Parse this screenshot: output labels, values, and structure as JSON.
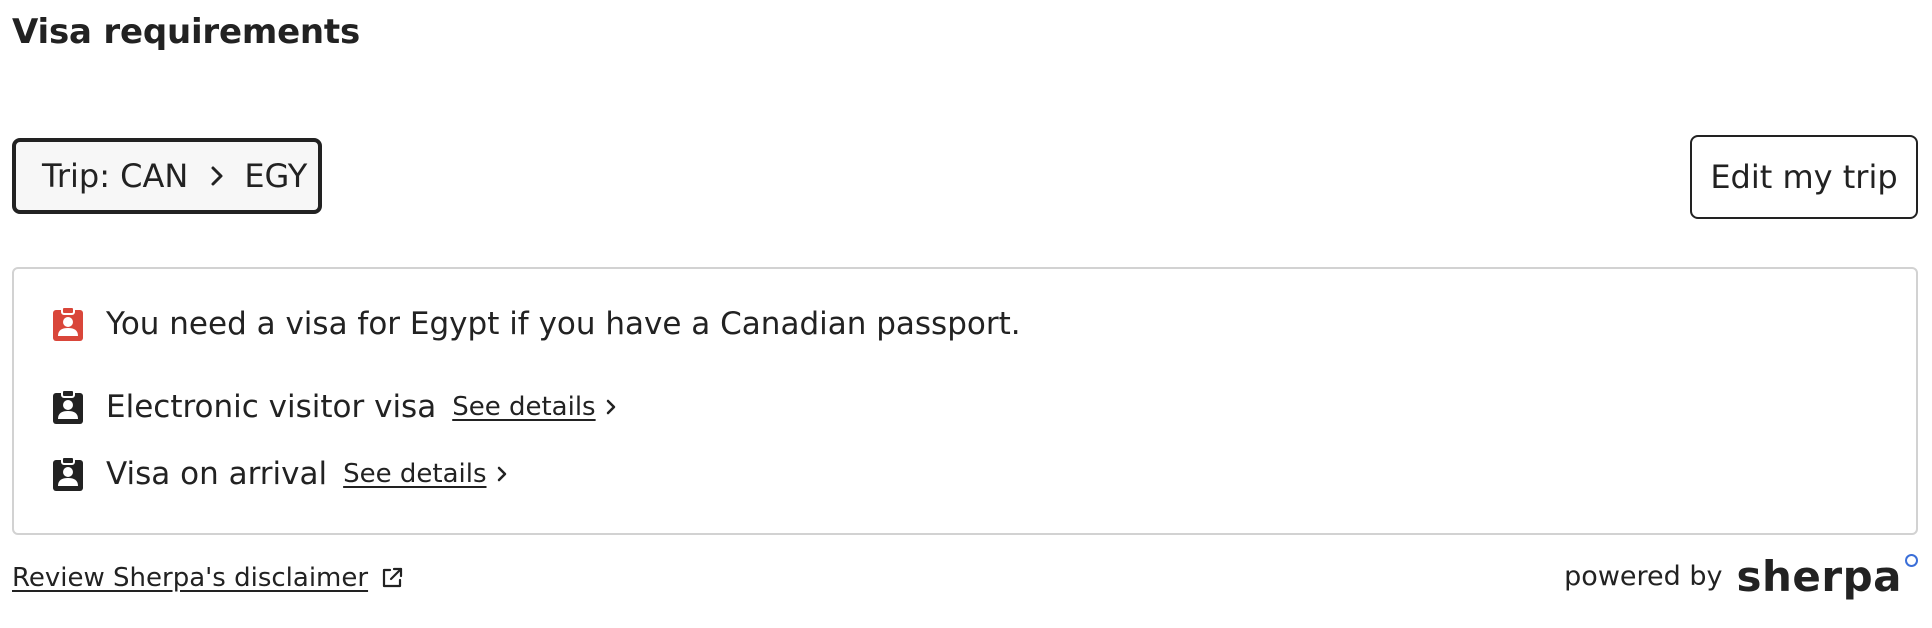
{
  "page": {
    "title": "Visa requirements"
  },
  "trip": {
    "label": "Trip: CAN",
    "destination": "EGY",
    "edit_label": "Edit my trip"
  },
  "requirements": {
    "summary": "You need a visa for Egypt if you have a Canadian passport.",
    "items": [
      {
        "label": "Electronic visitor visa",
        "link": "See details"
      },
      {
        "label": "Visa on arrival",
        "link": "See details"
      }
    ]
  },
  "footer": {
    "disclaimer": "Review Sherpa's disclaimer",
    "powered_by": "powered by",
    "brand": "sherpa"
  },
  "colors": {
    "text": "#222222",
    "alert_icon": "#d9463a",
    "brand_dot": "#3b6fd8",
    "card_border": "#d2d2d2"
  },
  "icons": {
    "summary_icon": "id-badge-icon",
    "item_icon": "id-badge-icon",
    "trip_separator": "chevron-right-icon",
    "link_chevron": "chevron-right-icon",
    "disclaimer_icon": "external-link-icon"
  }
}
